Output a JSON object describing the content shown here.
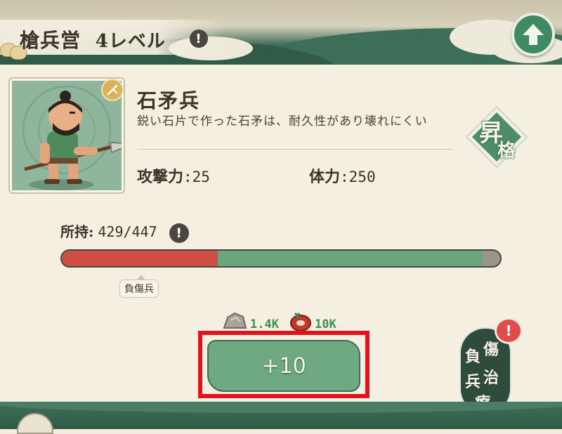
{
  "header": {
    "title": "槍兵営",
    "level": "4レベル",
    "info_icon": "!",
    "upgrade_icon": "up-arrow-icon"
  },
  "unit": {
    "name": "石矛兵",
    "description": "鋭い石片で作った石矛は、耐久性があり壊れにくい",
    "attack_label": "攻撃力",
    "attack_value": ":25",
    "hp_label": "体力",
    "hp_value": ":250",
    "promote_label_1": "昇",
    "promote_label_2": "格"
  },
  "inventory": {
    "label": "所持:",
    "value": "429/447",
    "info_icon": "!",
    "current": 429,
    "max": 447,
    "injured_fraction": 0.356,
    "injured_tooltip": "負傷兵"
  },
  "cost": {
    "stone": "1.4K",
    "food": "10K"
  },
  "train": {
    "button_label": "+10"
  },
  "heal": {
    "label_1": "負",
    "label_2": "傷",
    "label_3": "兵",
    "label_4": "治",
    "label_5": "療",
    "alert_icon": "!"
  },
  "colors": {
    "accent_green": "#6fa982",
    "health_green": "#6aa57b",
    "injured_red": "#cf4f45",
    "highlight_red": "#e0141b"
  }
}
